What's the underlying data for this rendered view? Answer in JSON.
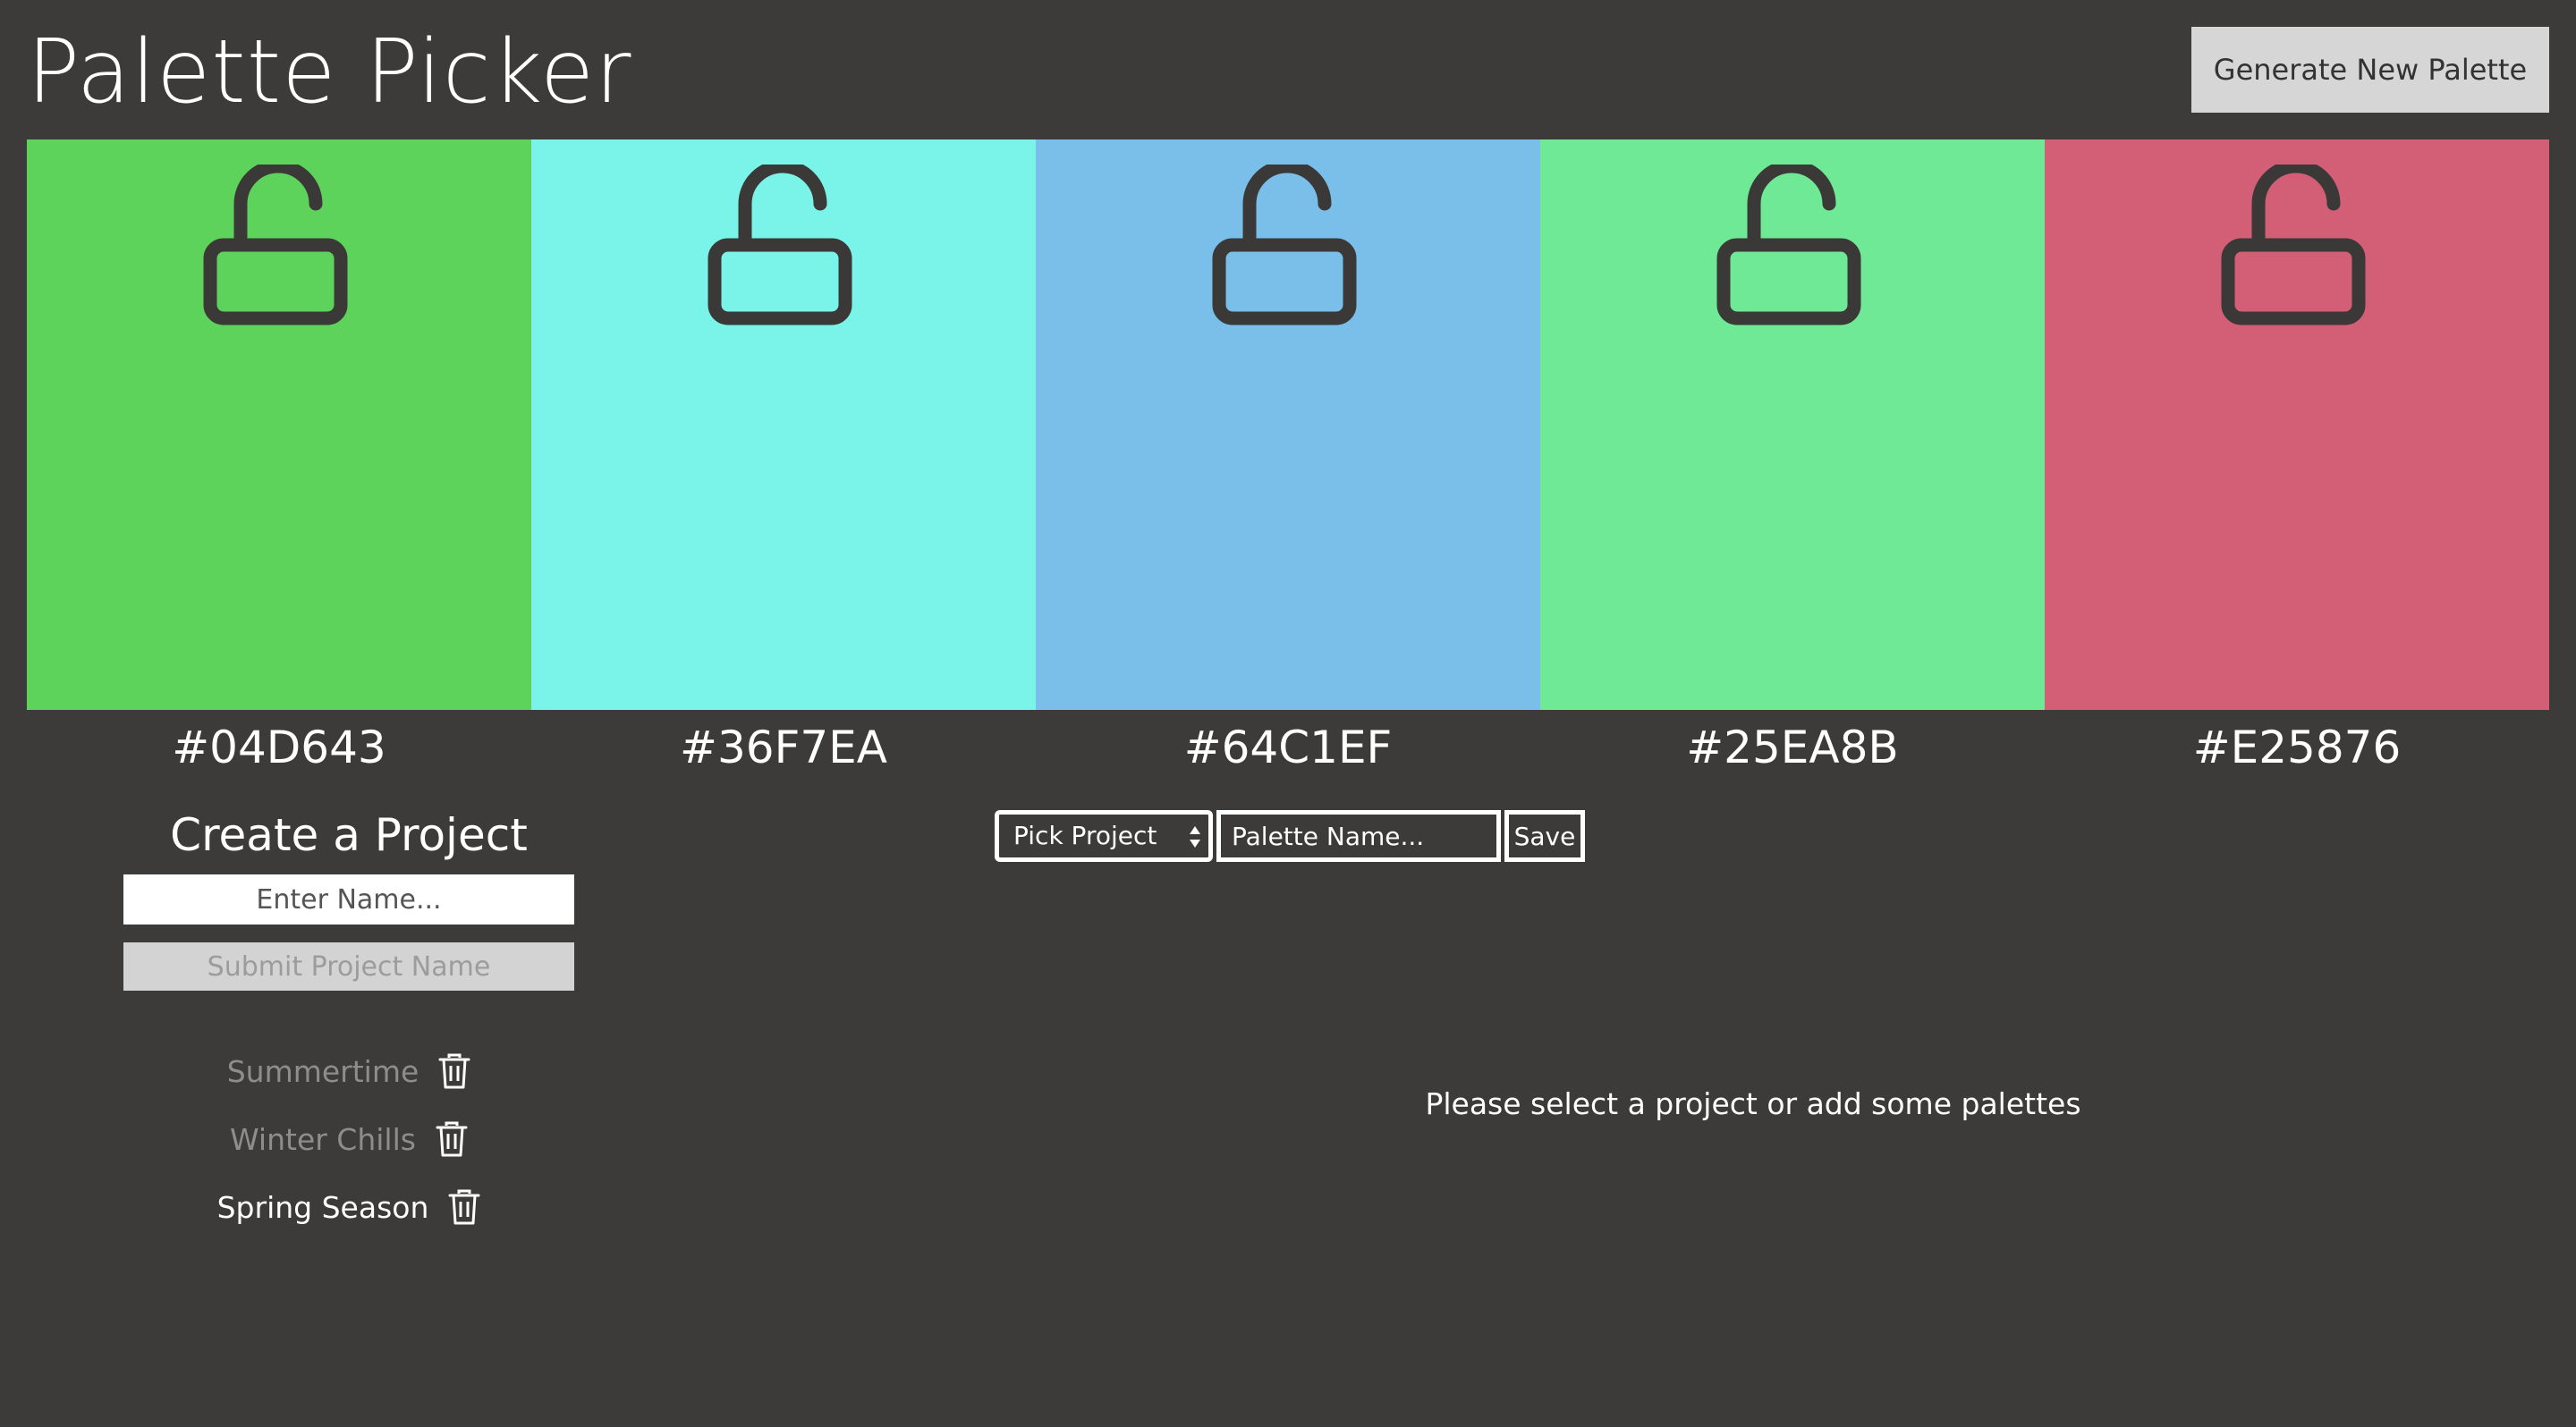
{
  "header": {
    "title": "Palette Picker",
    "generate_label": "Generate New Palette"
  },
  "palette": {
    "swatches": [
      {
        "hex": "#04D643",
        "display_color": "#5dd35b",
        "lock_icon": "unlocked-padlock-icon",
        "locked": false
      },
      {
        "hex": "#36F7EA",
        "display_color": "#7af4e8",
        "lock_icon": "unlocked-padlock-icon",
        "locked": false
      },
      {
        "hex": "#64C1EF",
        "display_color": "#79bfea",
        "lock_icon": "unlocked-padlock-icon",
        "locked": false
      },
      {
        "hex": "#25EA8B",
        "display_color": "#6fe996",
        "lock_icon": "unlocked-padlock-icon",
        "locked": false
      },
      {
        "hex": "#E25876",
        "display_color": "#d25f75",
        "lock_icon": "unlocked-padlock-icon",
        "locked": false
      }
    ]
  },
  "create_project": {
    "heading": "Create a Project",
    "input_placeholder": "Enter Name...",
    "input_value": "",
    "submit_label": "Submit Project Name"
  },
  "projects": [
    {
      "name": "Summertime",
      "state": "dim",
      "icon": "trash-icon"
    },
    {
      "name": "Winter Chills",
      "state": "dim",
      "icon": "trash-icon"
    },
    {
      "name": "Spring Season",
      "state": "active",
      "icon": "trash-icon"
    }
  ],
  "save_form": {
    "select_value": "Pick Project",
    "palette_name_placeholder": "Palette Name...",
    "palette_name_value": "",
    "save_label": "Save"
  },
  "message": "Please select a project or add some palettes",
  "colors": {
    "background": "#3c3b3a",
    "icon_stroke": "#3a3938",
    "button_bg": "#d6d6d6"
  }
}
